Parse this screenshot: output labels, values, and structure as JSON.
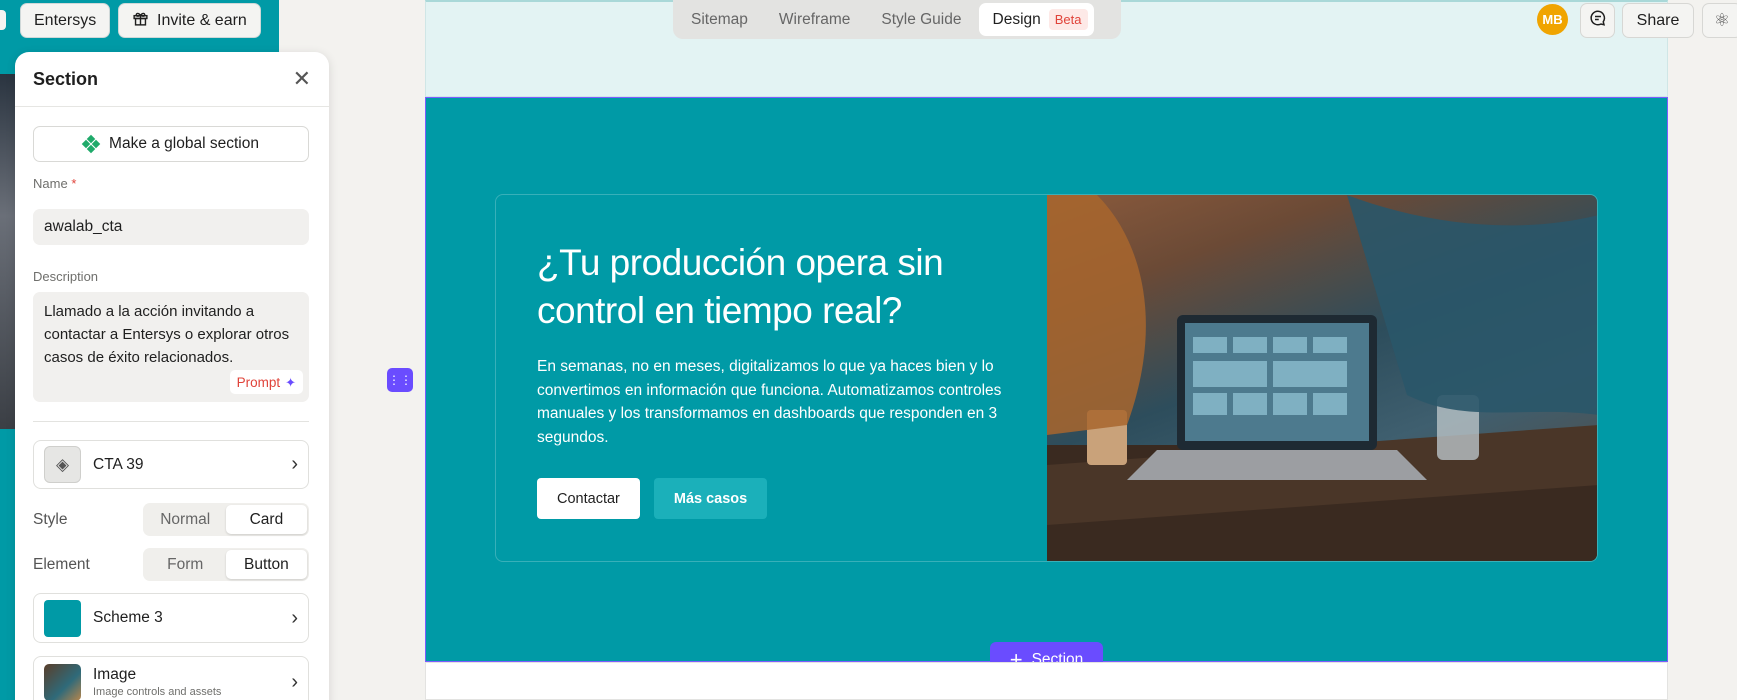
{
  "topbar": {
    "entersys_label": "Entersys",
    "invite_label": "Invite & earn",
    "tabs": [
      {
        "label": "Sitemap"
      },
      {
        "label": "Wireframe"
      },
      {
        "label": "Style Guide"
      },
      {
        "label": "Design",
        "badge": "Beta"
      }
    ],
    "avatar_initials": "MB",
    "share_label": "Share"
  },
  "panel": {
    "title": "Section",
    "global_button": "Make a global section",
    "name_label": "Name",
    "name_required_mark": "*",
    "name_value": "awalab_cta",
    "description_label": "Description",
    "description_value": "Llamado a la acción invitando a contactar a Entersys o explorar otros casos de éxito relacionados.",
    "prompt_label": "Prompt",
    "component_label": "CTA 39",
    "style_label": "Style",
    "style_options": [
      "Normal",
      "Card"
    ],
    "style_selected": "Card",
    "element_label": "Element",
    "element_options": [
      "Form",
      "Button"
    ],
    "element_selected": "Button",
    "scheme_label": "Scheme 3",
    "image_label": "Image",
    "image_sub": "Image controls and assets"
  },
  "cta": {
    "title": "¿Tu producción opera sin control en tiempo real?",
    "body": "En semanas, no en meses, digitalizamos lo que ya haces bien y lo convertimos en información que funciona. Automatizamos controles manuales y los transformamos en dashboards que responden en 3 segundos.",
    "primary_button": "Contactar",
    "secondary_button": "Más casos"
  },
  "add_section_label": "Section",
  "colors": {
    "section_bg": "#009aa6",
    "accent": "#6a4cff",
    "avatar": "#f0a400"
  }
}
